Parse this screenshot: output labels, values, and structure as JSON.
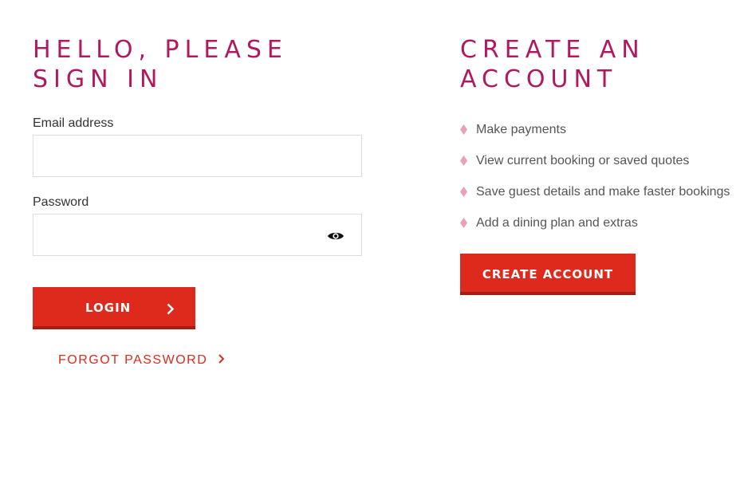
{
  "signin": {
    "heading_line1": "HELLO, PLEASE",
    "heading_line2": "SIGN IN",
    "email_label": "Email address",
    "email_value": "",
    "password_label": "Password",
    "password_value": "",
    "login_label": "LOGIN",
    "forgot_label": "FORGOT PASSWORD"
  },
  "create": {
    "heading_line1": "CREATE AN",
    "heading_line2": "ACCOUNT",
    "benefits": [
      "Make payments",
      "View current booking or saved quotes",
      "Save guest details and make faster bookings",
      "Add a dining plan and extras"
    ],
    "button_label": "CREATE ACCOUNT"
  },
  "icons": {
    "password_toggle": "eye-icon",
    "login_arrow": "chevron-right-icon",
    "forgot_arrow": "chevron-right-icon",
    "bullet": "diamond-icon"
  },
  "colors": {
    "heading": "#b0195f",
    "primary_button": "#dd2a1c",
    "link": "#dd2a1c",
    "bullet": "#e8a0b6"
  }
}
